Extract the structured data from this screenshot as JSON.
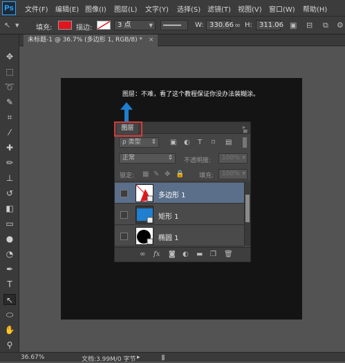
{
  "app": {
    "logo": "Ps"
  },
  "menu": [
    "文件(F)",
    "编辑(E)",
    "图像(I)",
    "图层(L)",
    "文字(Y)",
    "选择(S)",
    "滤镜(T)",
    "视图(V)",
    "窗口(W)",
    "帮助(H)"
  ],
  "options": {
    "fill_label": "填充:",
    "fill_color": "#e0151d",
    "stroke_label": "描边:",
    "stroke_size": "3 点",
    "w_label": "W:",
    "w_value": "330.66",
    "h_label": "H:",
    "h_value": "311.06"
  },
  "document": {
    "tab_title": "未标题-1 @ 36.7% (多边形 1, RGB/8) *",
    "close": "×"
  },
  "canvas": {
    "caption": "图层：不难，看了这个教程保证你没办法装糊涂。"
  },
  "layers_panel": {
    "tab_label": "图层",
    "kind_label": "ρ 类型",
    "blend_mode": "正常",
    "opacity_label": "不透明度:",
    "opacity_value": "100%",
    "lock_label": "锁定:",
    "fill_label": "填充:",
    "fill_value": "100%",
    "layers": [
      {
        "name": "多边形 1",
        "selected": true,
        "thumb": "polygon"
      },
      {
        "name": "矩形 1",
        "selected": false,
        "thumb": "rectangle"
      },
      {
        "name": "椭圆 1",
        "selected": false,
        "thumb": "ellipse"
      }
    ]
  },
  "status": {
    "zoom": "36.67%",
    "doc_size": "文档:3.99M/0 字节"
  },
  "colors": {
    "accent": "#31a8ff",
    "highlight": "#d63a3a",
    "arrow": "#1e7fd0",
    "selected_row": "#5b6f8a"
  }
}
